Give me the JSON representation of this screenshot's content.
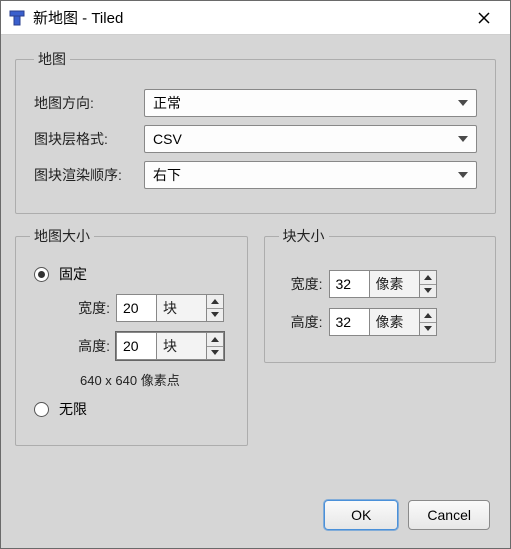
{
  "window": {
    "title": "新地图 - Tiled"
  },
  "map": {
    "legend": "地图",
    "orientation_label": "地图方向:",
    "orientation_value": "正常",
    "layer_format_label": "图块层格式:",
    "layer_format_value": "CSV",
    "render_order_label": "图块渲染顺序:",
    "render_order_value": "右下"
  },
  "map_size": {
    "legend": "地图大小",
    "fixed_label": "固定",
    "infinite_label": "无限",
    "width_label": "宽度:",
    "width_value": "20",
    "width_unit": "块",
    "height_label": "高度:",
    "height_value": "20",
    "height_unit": "块",
    "hint": "640 x 640 像素点"
  },
  "tile_size": {
    "legend": "块大小",
    "width_label": "宽度:",
    "width_value": "32",
    "width_unit": "像素",
    "height_label": "高度:",
    "height_value": "32",
    "height_unit": "像素"
  },
  "buttons": {
    "ok": "OK",
    "cancel": "Cancel"
  }
}
